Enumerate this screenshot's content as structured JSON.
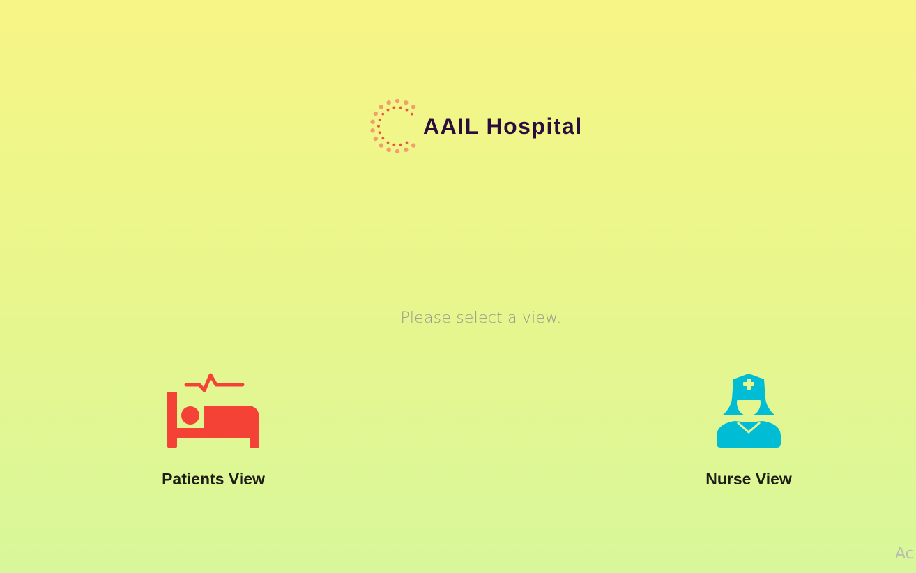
{
  "brand": {
    "title": "AAIL Hospital",
    "logo_icon": "dotted-circle-spinner-icon"
  },
  "prompt": "Please select a view.",
  "views": [
    {
      "label": "Patients View",
      "icon": "hospital-bed-patient-icon",
      "color": "#f44336"
    },
    {
      "label": "Nurse View",
      "icon": "nurse-icon",
      "color": "#00bcd4"
    }
  ],
  "watermark": "Ac",
  "colors": {
    "title": "#2a0c3d",
    "logo_dots_primary": "#f0a070",
    "logo_dots_accent": "#e8544a"
  }
}
